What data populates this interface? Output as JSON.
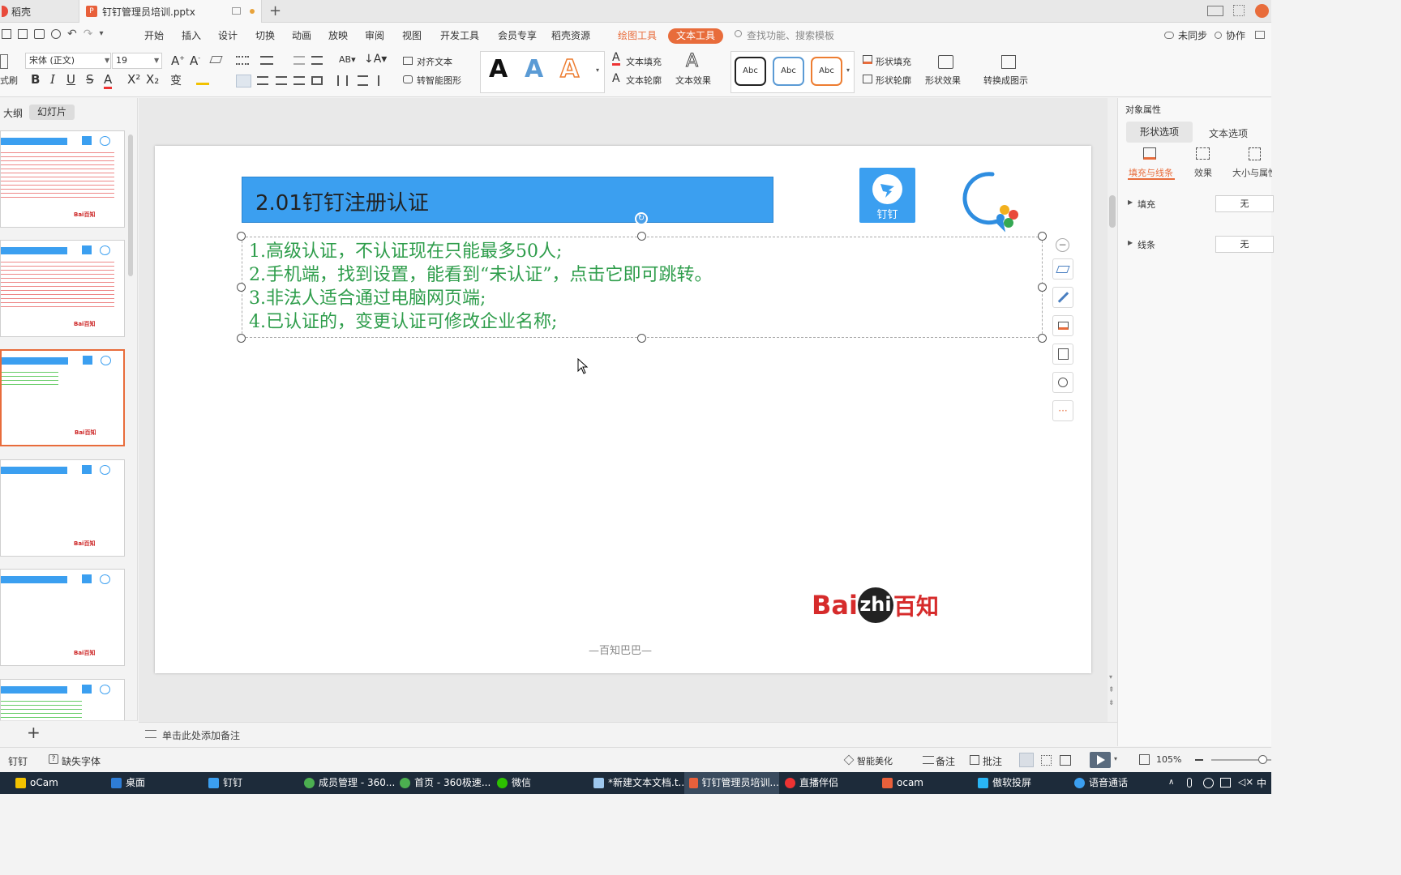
{
  "tabs": [
    {
      "label": "稻壳"
    },
    {
      "label": "钉钉管理员培训.pptx"
    }
  ],
  "menu": [
    "开始",
    "插入",
    "设计",
    "切换",
    "动画",
    "放映",
    "审阅",
    "视图",
    "开发工具",
    "会员专享",
    "稻壳资源",
    "绘图工具",
    "文本工具"
  ],
  "search_placeholder": "查找功能、搜索模板",
  "top_right": {
    "sync": "未同步",
    "collab": "协作"
  },
  "ribbon": {
    "format_painter": "式刷",
    "font": "宋体 (正文)",
    "font_size": "19",
    "align_text": "对齐文本",
    "smart_shape": "转智能图形",
    "text_fill": "文本填充",
    "text_outline": "文本轮廓",
    "text_effect": "文本效果",
    "style_sample": "Abc",
    "shape_fill": "形状填充",
    "shape_outline": "形状轮廓",
    "shape_effect": "形状效果",
    "convert": "转换成图示"
  },
  "left_tabs": {
    "outline": "大纲",
    "slides": "幻灯片"
  },
  "slide": {
    "title": "2.01钉钉注册认证",
    "logo_label": "钉钉",
    "lines": [
      "1.高级认证，不认证现在只能最多50人;",
      "2.手机端，找到设置，能看到“未认证”，点击它即可跳转。",
      "3.非法人适合通过电脑网页端;",
      "4.已认证的，变更认证可修改企业名称;"
    ],
    "brand_left": "Bai",
    "brand_mid": "zhi",
    "brand_right": "百知",
    "footer": "—百知巴巴—"
  },
  "thumb_brand": "Bai百知",
  "right_panel": {
    "title": "对象属性",
    "tab1": "形状选项",
    "tab2": "文本选项",
    "sub1": "填充与线条",
    "sub2": "效果",
    "sub3": "大小与属性",
    "fill_label": "填充",
    "fill_value": "无",
    "line_label": "线条",
    "line_value": "无"
  },
  "notes_placeholder": "单击此处添加备注",
  "status": {
    "app": "钉钉",
    "missing_font": "缺失字体",
    "beautify": "智能美化",
    "notes": "备注",
    "comments": "批注",
    "zoom": "105%"
  },
  "taskbar": [
    "oCam",
    "桌面",
    "钉钉",
    "成员管理 - 360...",
    "首页 - 360极速...",
    "微信",
    "*新建文本文档.t...",
    "钉钉管理员培训...",
    "直播伴侣",
    "ocam",
    "傲软投屏",
    "语音通话"
  ],
  "tray": {
    "ime": "中"
  },
  "colors": {
    "accent": "#e86c3b",
    "title_bar": "#3b9ff0",
    "body_text": "#2e9d4b",
    "brand_red": "#d62b2b"
  }
}
